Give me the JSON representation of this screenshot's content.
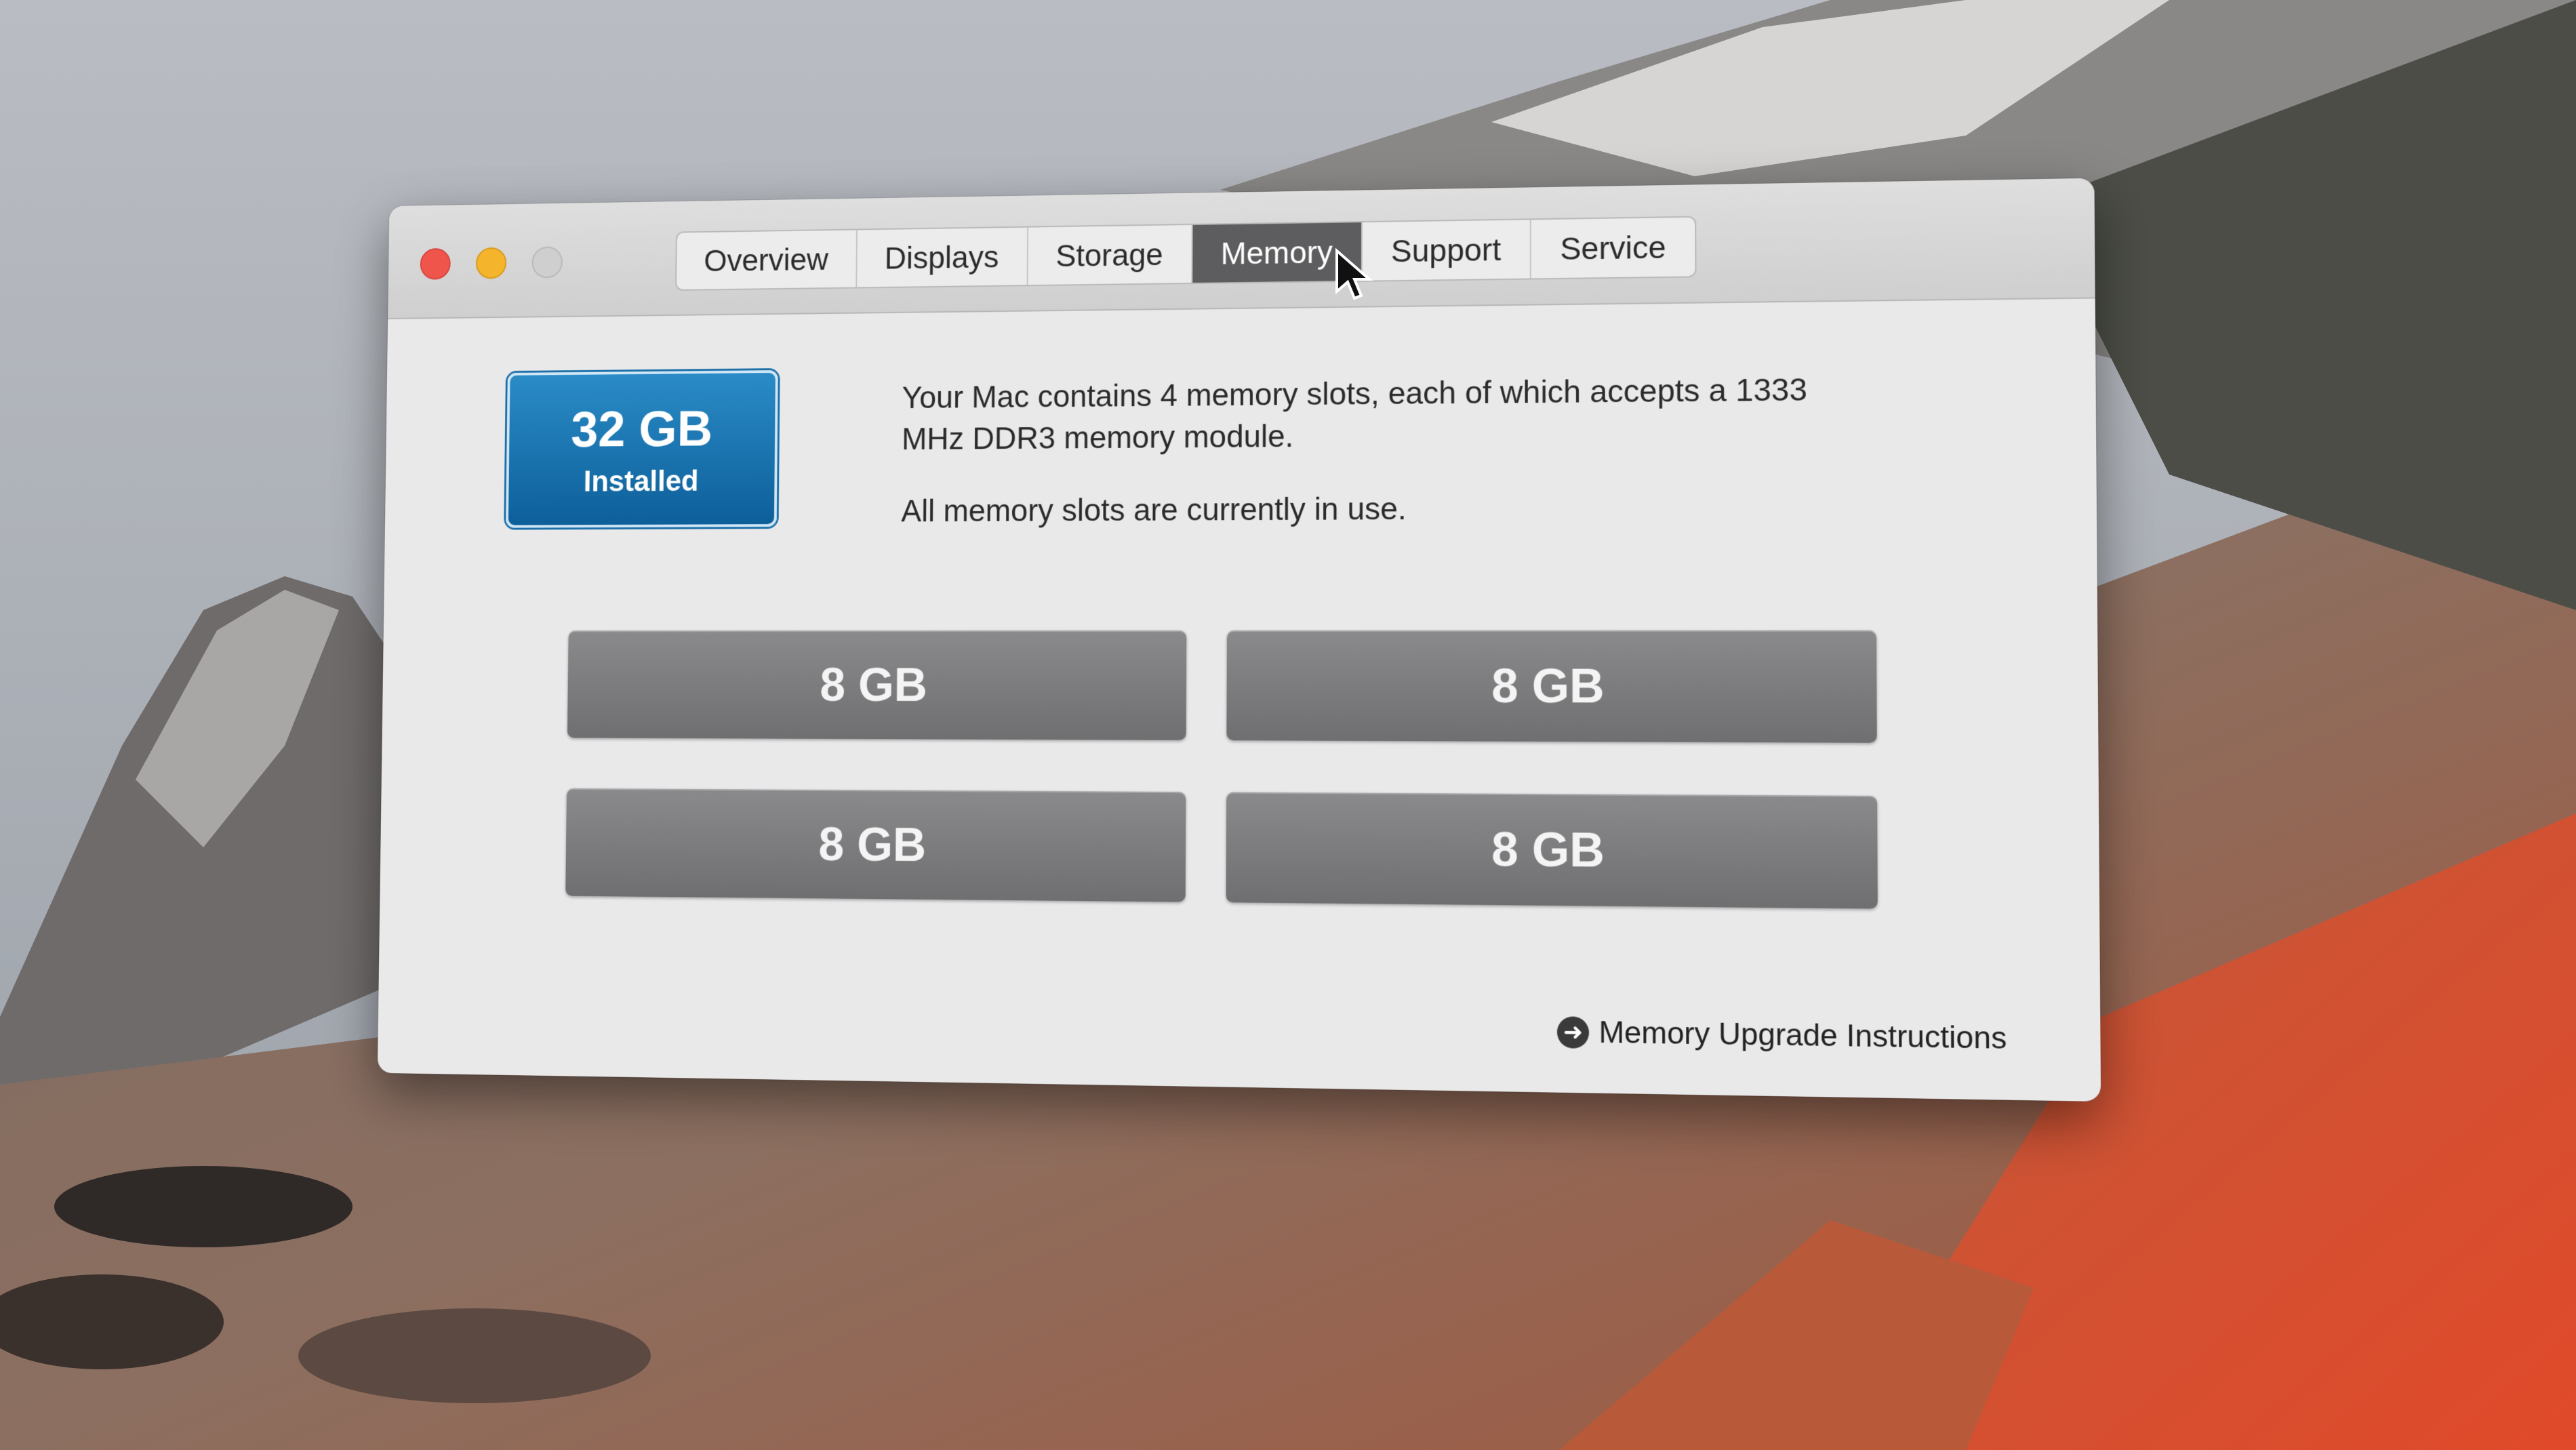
{
  "window": {
    "tabs": [
      {
        "label": "Overview",
        "active": false
      },
      {
        "label": "Displays",
        "active": false
      },
      {
        "label": "Storage",
        "active": false
      },
      {
        "label": "Memory",
        "active": true
      },
      {
        "label": "Support",
        "active": false
      },
      {
        "label": "Service",
        "active": false
      }
    ]
  },
  "memory": {
    "installed_size": "32 GB",
    "installed_label": "Installed",
    "description_line1": "Your Mac contains 4 memory slots, each of which accepts a 1333 MHz DDR3 memory module.",
    "description_line2": "All memory slots are currently in use.",
    "slots": [
      {
        "size": "8 GB"
      },
      {
        "size": "8 GB"
      },
      {
        "size": "8 GB"
      },
      {
        "size": "8 GB"
      }
    ],
    "upgrade_link": "Memory Upgrade Instructions"
  },
  "colors": {
    "badge_blue": "#1673b3",
    "slot_gray": "#7c7c7e",
    "active_tab": "#5d5d5f",
    "close_red": "#f0554c",
    "minimize_yellow": "#f4b52c"
  },
  "icons": {
    "upgrade_link_icon": "right-arrow-circle-icon",
    "cursor": "arrow-cursor-icon"
  }
}
